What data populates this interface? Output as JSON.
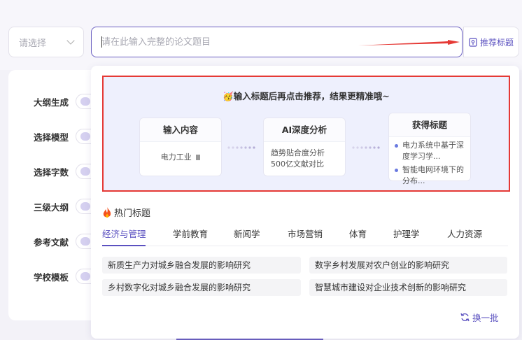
{
  "select": {
    "placeholder": "请选择"
  },
  "search": {
    "placeholder": "请在此输入完整的论文题目",
    "value": ""
  },
  "recommend_button": {
    "label": "推荐标题"
  },
  "sidebar": {
    "items": [
      {
        "label": "大纲生成"
      },
      {
        "label": "选择模型"
      },
      {
        "label": "选择字数"
      },
      {
        "label": "三级大纲"
      },
      {
        "label": "参考文献"
      },
      {
        "label": "学校模板"
      }
    ]
  },
  "tip": {
    "emoji": "🥳",
    "title": "输入标题后再点击推荐，结果更精准哦~",
    "steps": [
      {
        "title": "输入内容",
        "text": "电力工业"
      },
      {
        "title": "AI深度分析",
        "text": "趋势贴合度分析500亿文献对比"
      },
      {
        "title": "获得标题",
        "items": [
          "电力系统中基于深度学习学...",
          "智能电网环境下的分布..."
        ]
      }
    ]
  },
  "hot": {
    "label": "热门标题",
    "tabs": [
      "经济与管理",
      "学前教育",
      "新闻学",
      "市场营销",
      "体育",
      "护理学",
      "人力资源"
    ],
    "active_tab": 0,
    "topics": [
      "新质生产力对城乡融合发展的影响研究",
      "数字乡村发展对农户创业的影响研究",
      "乡村数字化对城乡融合发展的影响研究",
      "智慧城市建设对企业技术创新的影响研究"
    ],
    "refresh_label": "换一批"
  },
  "colors": {
    "accent": "#5b51c0",
    "highlight_border": "#e53935",
    "tip_bg": "#eef0fd"
  }
}
